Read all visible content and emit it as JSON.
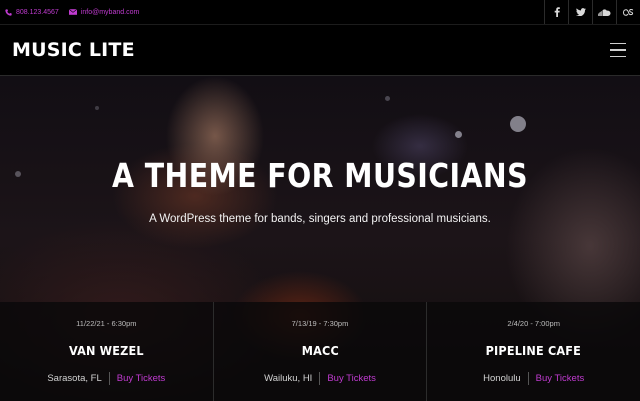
{
  "topbar": {
    "phone": "808.123.4567",
    "email": "info@myband.com",
    "social": [
      "facebook-icon",
      "twitter-icon",
      "soundcloud-icon",
      "lastfm-icon"
    ]
  },
  "header": {
    "logo": "MUSIC LITE"
  },
  "hero": {
    "title": "A THEME FOR MUSICIANS",
    "subtitle": "A WordPress theme for bands, singers and professional musicians."
  },
  "events": [
    {
      "date": "11/22/21 - 6:30pm",
      "name": "VAN WEZEL",
      "city": "Sarasota, FL",
      "tickets": "Buy Tickets"
    },
    {
      "date": "7/13/19 - 7:30pm",
      "name": "MACC",
      "city": "Wailuku, HI",
      "tickets": "Buy Tickets"
    },
    {
      "date": "2/4/20 - 7:00pm",
      "name": "PIPELINE CAFE",
      "city": "Honolulu",
      "tickets": "Buy Tickets"
    }
  ],
  "colors": {
    "accent": "#c03bd0",
    "background": "#000000"
  }
}
